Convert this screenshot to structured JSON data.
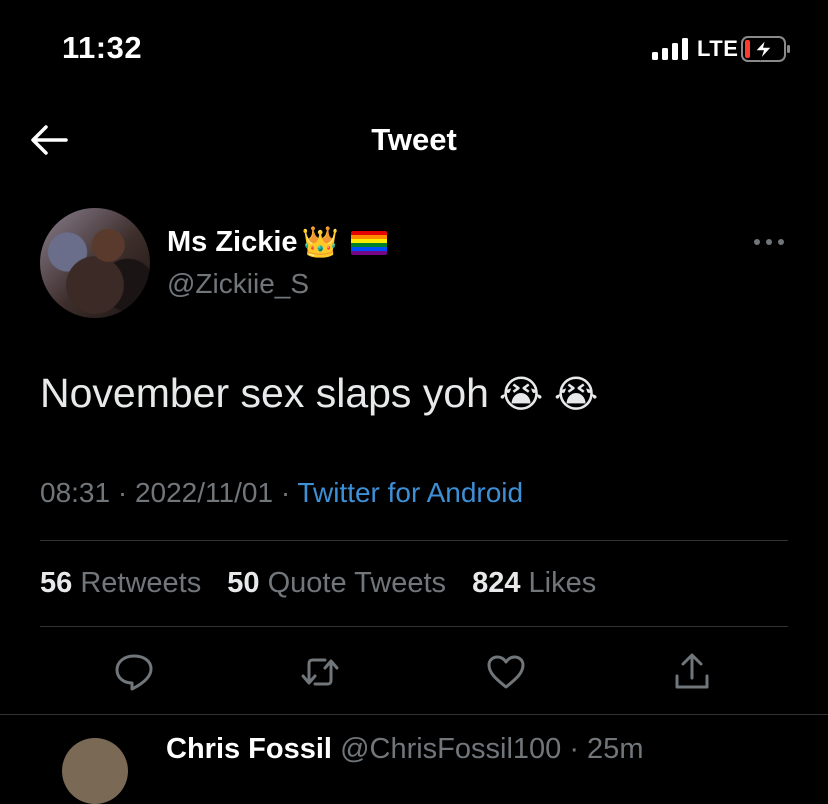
{
  "status_bar": {
    "time": "11:32",
    "network": "LTE",
    "battery_level": 0.1,
    "charging": true
  },
  "header": {
    "title": "Tweet",
    "back_icon": "arrow-left-icon"
  },
  "author": {
    "name": "Ms Zickie",
    "crown_emoji": "👑",
    "flag_colors": [
      "#e40303",
      "#ff8c00",
      "#ffed00",
      "#008026",
      "#004dff",
      "#750787"
    ],
    "handle": "@Zickiie_S"
  },
  "tweet": {
    "text": "November sex slaps yoh",
    "emojis": "😭 😭",
    "time": "08:31",
    "date": "2022/11/01",
    "separator": "·",
    "source": "Twitter for Android"
  },
  "stats": {
    "retweets_count": "56",
    "retweets_label": "Retweets",
    "quotes_count": "50",
    "quotes_label": "Quote Tweets",
    "likes_count": "824",
    "likes_label": "Likes"
  },
  "actions": [
    "reply-icon",
    "retweet-icon",
    "like-icon",
    "share-icon"
  ],
  "reply_preview": {
    "name": "Chris Fossil",
    "meta": "@ChrisFossil100 · 25m"
  },
  "colors": {
    "background": "#000000",
    "link": "#3d8fd6",
    "muted": "#71767b",
    "divider": "#2f3336"
  }
}
